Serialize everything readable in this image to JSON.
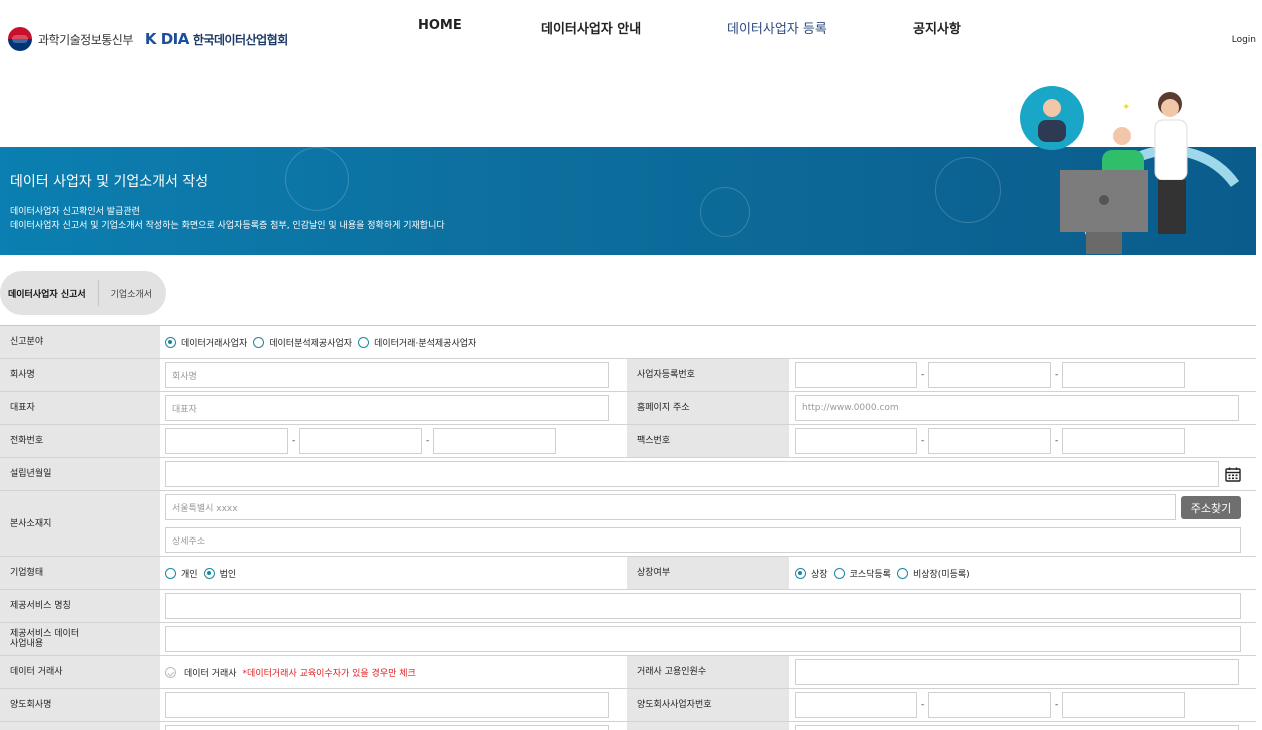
{
  "header": {
    "ministry": "과학기술정보통신부",
    "kodia": "K DIA",
    "kodia_name": "한국데이터산업협회",
    "nav": [
      "HOME",
      "데이터사업자 안내",
      "데이터사업자 등록",
      "공지사항"
    ],
    "login": "Login"
  },
  "banner": {
    "title": "데이터 사업자 및 기업소개서 작성",
    "sub1": "데이터사업자 신고확인서 발급관련",
    "sub2": "데이터사업자 신고서 및 기업소개서 작성하는 화면으로 사업자등록증 첨부, 인감날인 및 내용을 정확하게 기재합니다"
  },
  "tabs": [
    "데이터사업자 신고서",
    "기업소개서"
  ],
  "form": {
    "field": {
      "label": "신고분야",
      "options": [
        "데이터거래사업자",
        "데이터분석제공사업자",
        "데이터거래·분석제공사업자"
      ]
    },
    "company_name": {
      "label": "회사명",
      "placeholder": "회사명"
    },
    "biz_number": {
      "label": "사업자등록번호"
    },
    "ceo": {
      "label": "대표자",
      "placeholder": "대표자"
    },
    "homepage": {
      "label": "홈페이지 주소",
      "placeholder": "http://www.0000.com"
    },
    "phone": {
      "label": "전화번호"
    },
    "fax": {
      "label": "팩스번호"
    },
    "founded": {
      "label": "설립년월일"
    },
    "address": {
      "label": "본사소재지",
      "placeholder": "서울특별시 xxxx",
      "detail_placeholder": "상세주소",
      "button": "주소찾기"
    },
    "company_type": {
      "label": "기업형태",
      "options": [
        "개인",
        "법인"
      ]
    },
    "listing": {
      "label": "상장여부",
      "options": [
        "상장",
        "코스닥등록",
        "비상장(미등록)"
      ]
    },
    "service_name": {
      "label": "제공서비스 명칭"
    },
    "service_desc": {
      "label_line1": "제공서비스 데이터",
      "label_line2": "사업내용"
    },
    "broker": {
      "label": "데이터 거래사",
      "check_label": "데이터 거래사",
      "note": "*데이터거래사 교육이수자가 있을 경우만 체크"
    },
    "broker_staff": {
      "label": "거래사 고용인원수"
    },
    "transfer_company": {
      "label": "양도회사명"
    },
    "transfer_biz_number": {
      "label": "양도회사사업자번호"
    },
    "dash": "-"
  }
}
